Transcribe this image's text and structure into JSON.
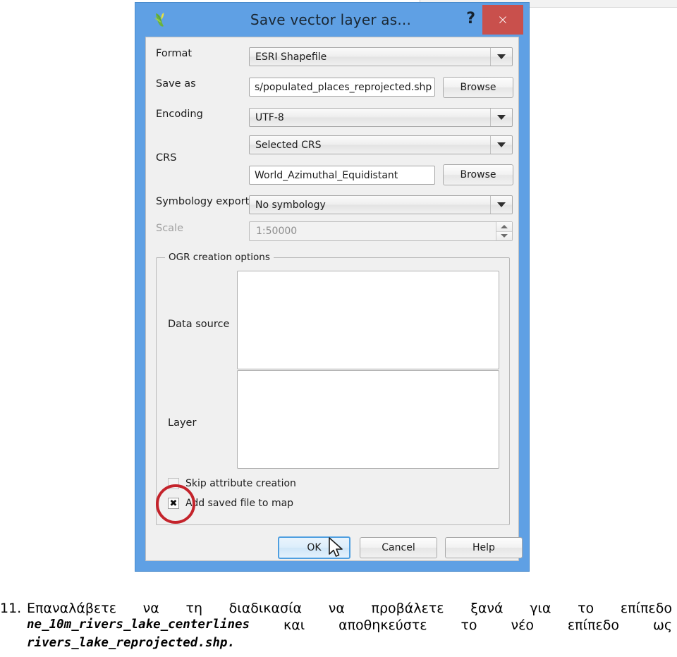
{
  "dialog": {
    "title": "Save vector layer as...",
    "icon": "qgis-logo-icon",
    "help_label": "?",
    "close_label": "×"
  },
  "form": {
    "format": {
      "label": "Format",
      "value": "ESRI Shapefile"
    },
    "save_as": {
      "label": "Save as",
      "value": "s/populated_places_reprojected.shp",
      "browse_label": "Browse"
    },
    "encoding": {
      "label": "Encoding",
      "value": "UTF-8"
    },
    "crs": {
      "label": "CRS",
      "mode_value": "Selected CRS",
      "name_value": "World_Azimuthal_Equidistant",
      "browse_label": "Browse"
    },
    "symbology_export": {
      "label": "Symbology export",
      "value": "No symbology"
    },
    "scale": {
      "label": "Scale",
      "value": "1:50000",
      "disabled": true
    }
  },
  "ogr_group": {
    "title": "OGR creation options",
    "data_source": {
      "label": "Data source",
      "value": ""
    },
    "layer": {
      "label": "Layer",
      "value": ""
    },
    "skip_attribute": {
      "label": "Skip attribute creation",
      "checked": false,
      "mark": ""
    },
    "add_saved_file": {
      "label": "Add saved file to map",
      "checked": true,
      "mark": "✖"
    }
  },
  "buttons": {
    "ok": "OK",
    "cancel": "Cancel",
    "help": "Help"
  },
  "annotation": {
    "shape": "red-ellipse-highlight",
    "color": "#c4232b",
    "targets": "add-saved-file-to-map-checkbox"
  },
  "caption": {
    "number": "11.",
    "line1_words": [
      "Επαναλάβετε",
      "να",
      "τη",
      "διαδικασία",
      "να",
      "προβάλετε",
      "ξανά",
      "για",
      "το",
      "επίπεδο"
    ],
    "line2_mono": "ne_10m_rivers_lake_centerlines",
    "line2_words": [
      "και",
      "αποθηκεύστε",
      "το",
      "νέο",
      "επίπεδο",
      "ως"
    ],
    "line3_mono": "rivers_lake_reprojected.shp."
  },
  "colors": {
    "titlebar": "#5fa0e4",
    "close_button": "#c9504c",
    "client_bg": "#f0f0f0",
    "annotation_red": "#c4232b",
    "focus_blue": "#4f9fe0"
  }
}
